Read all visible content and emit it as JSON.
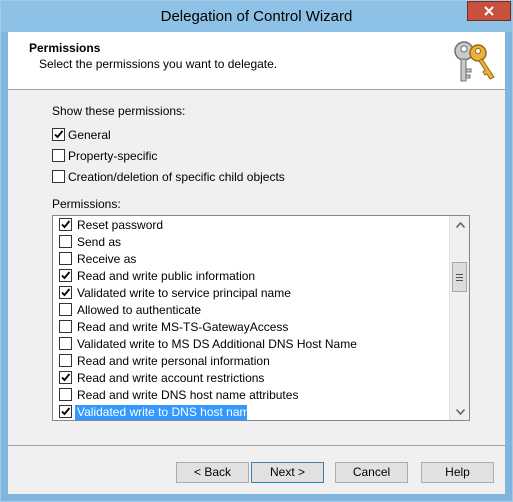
{
  "window": {
    "title": "Delegation of Control Wizard"
  },
  "header": {
    "title": "Permissions",
    "subtitle": "Select the permissions you want to delegate."
  },
  "show_label": "Show these permissions:",
  "filters": [
    {
      "label": "General",
      "checked": true
    },
    {
      "label": "Property-specific",
      "checked": false
    },
    {
      "label": "Creation/deletion of specific child objects",
      "checked": false
    }
  ],
  "permissions_label": "Permissions:",
  "permissions": [
    {
      "label": "Reset password",
      "checked": true
    },
    {
      "label": "Send as",
      "checked": false
    },
    {
      "label": "Receive as",
      "checked": false
    },
    {
      "label": "Read and write public information",
      "checked": true
    },
    {
      "label": "Validated write to service principal name",
      "checked": true
    },
    {
      "label": "Allowed to authenticate",
      "checked": false
    },
    {
      "label": "Read and write MS-TS-GatewayAccess",
      "checked": false
    },
    {
      "label": "Validated write to MS DS Additional DNS Host Name",
      "checked": false
    },
    {
      "label": "Read and write personal information",
      "checked": false
    },
    {
      "label": "Read and write account restrictions",
      "checked": true
    },
    {
      "label": "Read and write DNS host name attributes",
      "checked": false
    },
    {
      "label": "Validated write to DNS host name",
      "checked": true,
      "selected": true
    }
  ],
  "buttons": {
    "back": "< Back",
    "next": "Next >",
    "cancel": "Cancel",
    "help": "Help"
  },
  "icons": {
    "close": "close-icon",
    "header": "keys-icon",
    "scroll_up": "scroll-up-arrow-icon",
    "scroll_down": "scroll-down-arrow-icon"
  },
  "colors": {
    "title_bar": "#8dc1e6",
    "close": "#c7513c",
    "selection": "#3399ff"
  }
}
